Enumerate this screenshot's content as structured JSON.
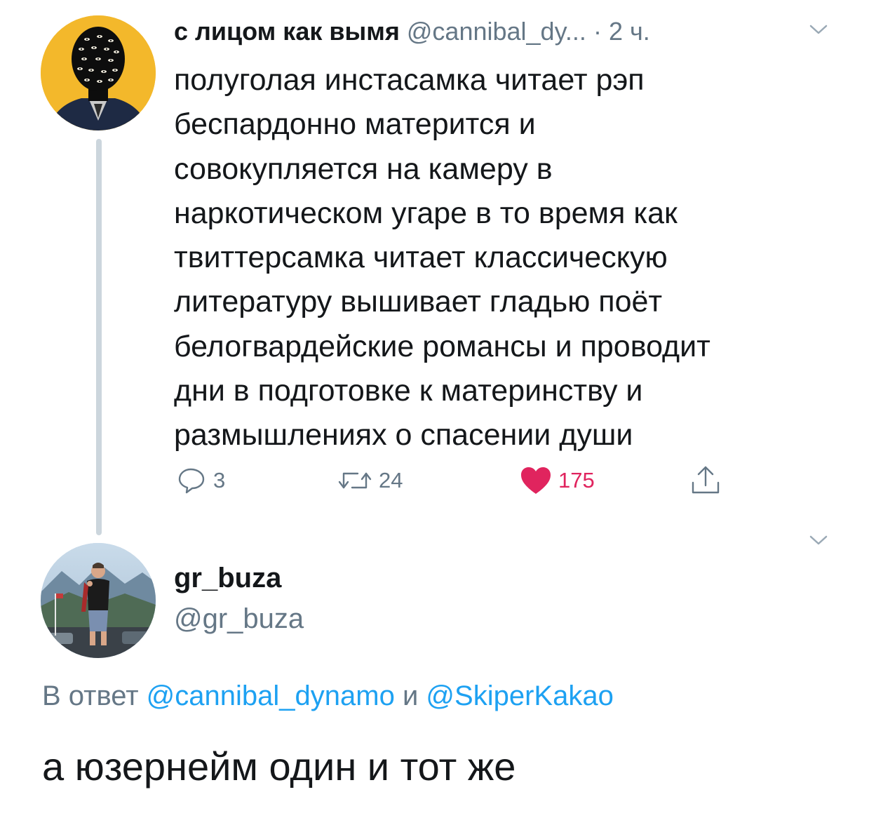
{
  "parent_tweet": {
    "display_name": "с лицом как вымя",
    "handle": "@cannibal_dy...",
    "separator": "·",
    "time": "2 ч.",
    "text_lines": [
      "полуголая инстасамка читает рэп",
      "беспардонно матерится и",
      "совокупляется на камеру в",
      "наркотическом угаре в то время как",
      "твиттерсамка читает классическую",
      "литературу вышивает гладью поёт",
      "белогвардейские романсы и проводит",
      "дни в подготовке к материнству и",
      "размышлениях о спасении души"
    ],
    "actions": {
      "reply_count": "3",
      "retweet_count": "24",
      "like_count": "175"
    },
    "icons": {
      "avatar": "avatar-eyes-face-icon",
      "menu": "chevron-down-icon",
      "reply": "reply-bubble-icon",
      "retweet": "retweet-icon",
      "like": "heart-icon",
      "share": "share-icon"
    }
  },
  "reply_tweet": {
    "display_name": "gr_buza",
    "handle": "@gr_buza",
    "reply_prefix": "В ответ",
    "mention_1": "@cannibal_dynamo",
    "reply_joiner": "и",
    "mention_2": "@SkiperKakao",
    "text": "а юзернейм один и тот же",
    "icons": {
      "avatar": "avatar-photo-icon",
      "menu": "chevron-down-icon"
    }
  },
  "colors": {
    "text_primary": "#14171a",
    "text_secondary": "#657786",
    "link": "#1da1f2",
    "like": "#e0245e",
    "thread_line": "#ccd6dd",
    "avatar_parent_bg": "#f3b82b"
  }
}
